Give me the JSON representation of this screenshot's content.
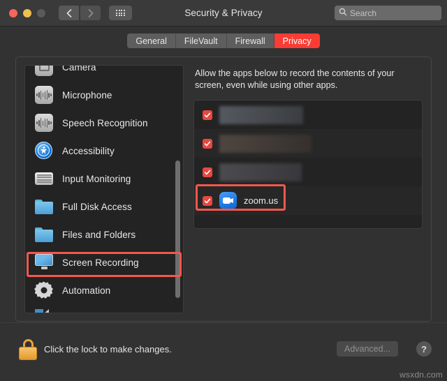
{
  "window": {
    "title": "Security & Privacy",
    "traffic_lights": [
      "close",
      "minimize",
      "zoom"
    ],
    "nav": {
      "back": "back-chevron",
      "forward": "forward-chevron",
      "grid": "show-all-grid"
    },
    "search": {
      "placeholder": "Search",
      "value": ""
    }
  },
  "tabs": [
    {
      "label": "General",
      "active": false
    },
    {
      "label": "FileVault",
      "active": false
    },
    {
      "label": "Firewall",
      "active": false
    },
    {
      "label": "Privacy",
      "active": true
    }
  ],
  "sidebar": {
    "items": [
      {
        "label": "Camera",
        "icon": "camera-icon",
        "selected": false,
        "clipped": true
      },
      {
        "label": "Microphone",
        "icon": "microphone-icon",
        "selected": false
      },
      {
        "label": "Speech Recognition",
        "icon": "speech-recognition-icon",
        "selected": false
      },
      {
        "label": "Accessibility",
        "icon": "accessibility-icon",
        "selected": false
      },
      {
        "label": "Input Monitoring",
        "icon": "keyboard-icon",
        "selected": false
      },
      {
        "label": "Full Disk Access",
        "icon": "folder-icon",
        "selected": false
      },
      {
        "label": "Files and Folders",
        "icon": "folder-icon",
        "selected": false
      },
      {
        "label": "Screen Recording",
        "icon": "display-icon",
        "selected": true
      },
      {
        "label": "Automation",
        "icon": "gear-icon",
        "selected": false
      },
      {
        "label": "",
        "icon": "partial-icon",
        "selected": false,
        "clipped": true
      }
    ]
  },
  "pane": {
    "description": "Allow the apps below to record the contents of your screen, even while using other apps.",
    "app_rows": [
      {
        "name": "",
        "checked": true,
        "redacted": true,
        "highlighted": false
      },
      {
        "name": "",
        "checked": true,
        "redacted": true,
        "highlighted": false
      },
      {
        "name": "",
        "checked": true,
        "redacted": true,
        "highlighted": false
      },
      {
        "name": "zoom.us",
        "checked": true,
        "redacted": false,
        "highlighted": true,
        "icon": "zoom-video-camera-icon"
      }
    ]
  },
  "footer": {
    "lock_icon": "lock-closed-icon",
    "lock_text": "Click the lock to make changes.",
    "advanced_label": "Advanced...",
    "help_label": "?",
    "watermark": "wsxdn.com"
  },
  "colors": {
    "accent_red": "#fa3c34",
    "highlight_red": "#f2584e",
    "checkbox_red": "#e8473f",
    "zoom_blue": "#1a7ae8",
    "window_bg": "#323232",
    "list_bg": "#232323"
  }
}
